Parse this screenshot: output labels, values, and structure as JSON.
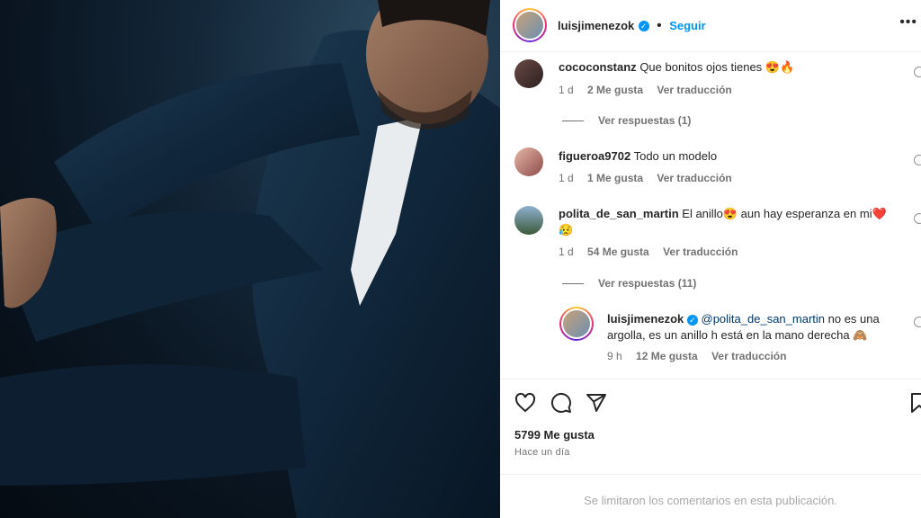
{
  "post": {
    "author": "luisjimenezok",
    "follow_label": "Seguir",
    "more_label": "•••"
  },
  "comments": [
    {
      "user": "cococonstanz",
      "text": "Que bonitos ojos tienes 😍🔥",
      "time": "1 d",
      "likes": "2 Me gusta",
      "translate": "Ver traducción",
      "replies": "Ver respuestas (1)"
    },
    {
      "user": "figueroa9702",
      "text": "Todo un modelo",
      "time": "1 d",
      "likes": "1 Me gusta",
      "translate": "Ver traducción"
    },
    {
      "user": "polita_de_san_martin",
      "text": "El anillo😍 aun hay esperanza en mi❤️",
      "text2": "😥",
      "time": "1 d",
      "likes": "54 Me gusta",
      "translate": "Ver traducción",
      "replies": "Ver respuestas (11)"
    }
  ],
  "reply": {
    "user": "luisjimenezok",
    "mention": "@polita_de_san_martin",
    "text_line1": " no es una",
    "text_line2": "argolla, es un anillo h está en la mano derecha 🙈",
    "time": "9 h",
    "likes": "12 Me gusta",
    "translate": "Ver traducción"
  },
  "stats": {
    "likes": "5799 Me gusta",
    "when": "Hace un día"
  },
  "footer": "Se limitaron los comentarios en esta publicación.",
  "colors": {
    "accent": "#0095f6",
    "muted": "#737373",
    "text": "#262626"
  },
  "icons": [
    "heart-icon",
    "comment-icon",
    "share-icon",
    "bookmark-icon",
    "verified-icon",
    "more-icon"
  ]
}
